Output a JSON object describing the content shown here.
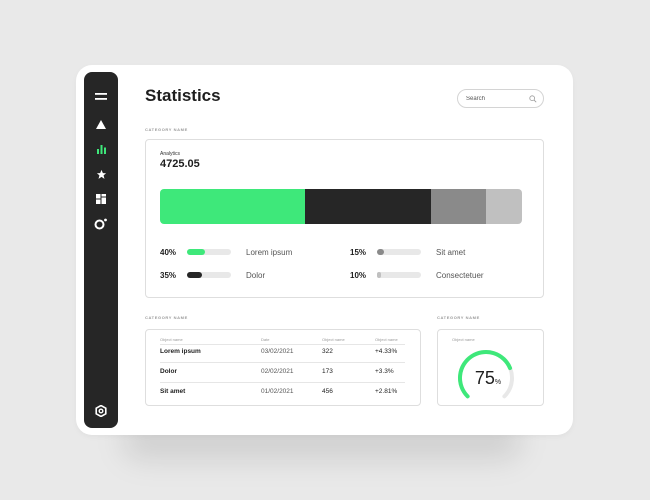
{
  "page": {
    "title": "Statistics"
  },
  "search": {
    "placeholder": "Search"
  },
  "sidebar": {
    "items": [
      {
        "icon": "menu-icon"
      },
      {
        "icon": "triangle-icon"
      },
      {
        "icon": "bar-chart-icon",
        "active": true
      },
      {
        "icon": "star-icon"
      },
      {
        "icon": "dashboard-icon"
      },
      {
        "icon": "ring-notification-icon"
      }
    ],
    "bottom_icon": "settings-icon"
  },
  "colors": {
    "accent": "#3ee87a",
    "dark": "#262626",
    "mid": "#8a8a8a",
    "light": "#c0c0c0"
  },
  "section1": {
    "category": "CATEGORY NAME",
    "analytics_label": "Analytics",
    "analytics_value": "4725.05",
    "segments": [
      {
        "label": "Lorem ipsum",
        "percent": "40%",
        "value": 40,
        "color": "#3ee87a"
      },
      {
        "label": "Dolor",
        "percent": "35%",
        "value": 35,
        "color": "#262626"
      },
      {
        "label": "Sit amet",
        "percent": "15%",
        "value": 15,
        "color": "#8a8a8a"
      },
      {
        "label": "Consectetuer",
        "percent": "10%",
        "value": 10,
        "color": "#c0c0c0"
      }
    ]
  },
  "section2": {
    "category": "CATEGORY NAME",
    "table": {
      "headers": [
        "Object name",
        "Date",
        "Object name",
        "Object name"
      ],
      "rows": [
        {
          "name": "Lorem ipsum",
          "date": "03/02/2021",
          "value": "322",
          "change": "+4.33%"
        },
        {
          "name": "Dolor",
          "date": "02/02/2021",
          "value": "173",
          "change": "+3.3%"
        },
        {
          "name": "Sit amet",
          "date": "01/02/2021",
          "value": "456",
          "change": "+2.81%"
        }
      ]
    }
  },
  "section3": {
    "category": "CATEGORY NAME",
    "object_label": "Object name",
    "gauge_value": "75",
    "gauge_unit": "%",
    "gauge_fraction": 0.75
  }
}
